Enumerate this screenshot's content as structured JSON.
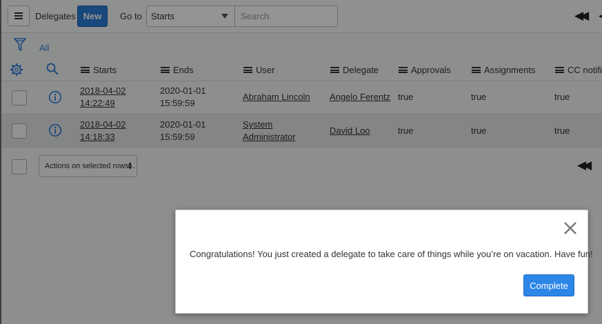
{
  "header": {
    "title": "Delegates",
    "new_label": "New",
    "goto_label": "Go to",
    "goto_value": "Starts",
    "search_placeholder": "Search",
    "first_page_glyph": "◀◀",
    "prev_page_glyph": "◀"
  },
  "filter": {
    "all_label": "All"
  },
  "columns": [
    "Starts",
    "Ends",
    "User",
    "Delegate",
    "Approvals",
    "Assignments",
    "CC notific"
  ],
  "rows": [
    {
      "starts": [
        "2018-04-02",
        "14:22:49"
      ],
      "ends": [
        "2020-01-01",
        "15:59:59"
      ],
      "user": [
        "Abraham Lincoln"
      ],
      "delegate": "Angelo Ferentz",
      "approvals": "true",
      "assignments": "true",
      "cc": "true"
    },
    {
      "starts": [
        "2018-04-02",
        "14:18:33"
      ],
      "ends": [
        "2020-01-01",
        "15:59:59"
      ],
      "user": [
        "System",
        "Administrator"
      ],
      "delegate": "David Loo",
      "approvals": "true",
      "assignments": "true",
      "cc": "true"
    }
  ],
  "footer": {
    "actions_label": "Actions on selected rows...",
    "first_page_glyph": "◀◀"
  },
  "modal": {
    "message": "Congratulations! You just created a delegate to take care of things while you’re on vacation. Have fun!",
    "complete_label": "Complete"
  },
  "colors": {
    "primary": "#2c7cd6",
    "link_blue": "#2c7cd6",
    "overlay": "rgba(0,0,0,0.42)"
  }
}
